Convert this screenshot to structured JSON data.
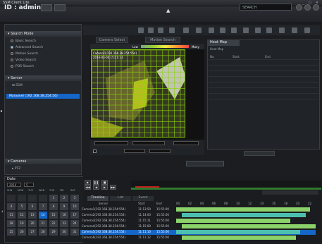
{
  "window": {
    "title": "SSM Client Lite",
    "controls": "_ ▢ ✕"
  },
  "header": {
    "user": "ID : admin",
    "search_label": "SEARCH"
  },
  "sidebar": {
    "search_mode_title": "Search Mode",
    "modes": [
      {
        "label": "Basic Search",
        "selected": false
      },
      {
        "label": "Advanced Search",
        "selected": true
      },
      {
        "label": "Motion Search",
        "selected": false
      },
      {
        "label": "Video Search",
        "selected": false
      },
      {
        "label": "POS Search",
        "selected": false
      }
    ],
    "server_title": "Server",
    "server_node": "SSM",
    "device_label": "Maroonel (192.168.38.254:56)",
    "cameras_title": "Cameras",
    "cameras_node": "PTZ"
  },
  "tabs": {
    "camera_select": "Camera Select",
    "motion_search": "Motion Search",
    "heat_map": "Heat Map"
  },
  "video": {
    "camera_name": "Camera1(192.168.38.254:554)",
    "timestamp": "2016-03-04 15:11:13",
    "legend_low": "Low",
    "legend_high": "Many"
  },
  "heatmap": {
    "subtitle": "Heat Map",
    "columns": [
      "No.",
      "Start",
      "End"
    ]
  },
  "calendar": {
    "title": "Date",
    "year": "2014",
    "month": "5",
    "days_header": [
      "SUN",
      "MON",
      "TUE",
      "WED",
      "THU",
      "FRI",
      "SAT"
    ],
    "weeks": [
      [
        "",
        "",
        "",
        "",
        "1",
        "2",
        "3"
      ],
      [
        "4",
        "5",
        "6",
        "7",
        "8",
        "9",
        "10"
      ],
      [
        "11",
        "12",
        "13",
        "14",
        "15",
        "16",
        "17"
      ],
      [
        "18",
        "19",
        "20",
        "21",
        "22",
        "23",
        "24"
      ],
      [
        "25",
        "26",
        "27",
        "28",
        "29",
        "30",
        "31"
      ]
    ],
    "selected_day": "14"
  },
  "timeline": {
    "tabs": [
      "Timeline",
      "List",
      "Event"
    ],
    "headers": [
      "Server",
      "Start",
      "End"
    ],
    "hours": [
      "00",
      "02",
      "04",
      "06",
      "08",
      "10",
      "12",
      "14",
      "16",
      "18",
      "20",
      "22"
    ],
    "rows": [
      {
        "name": "Camera1(192.168.38.254:554)",
        "start": "11:13:50",
        "end": "15:55:00"
      },
      {
        "name": "Camera2(192.168.38.254:554)",
        "start": "11:14:00",
        "end": "15:55:00"
      },
      {
        "name": "Camera3(192.168.38.254:554)",
        "start": "11:15:11",
        "end": "15:55:00"
      },
      {
        "name": "Camera4(192.168.38.254:554)",
        "start": "11:15:00",
        "end": "15:55:00"
      },
      {
        "name": "Camera5(192.168.38.254:554)",
        "start": "11:11:10",
        "end": "15:55:00"
      },
      {
        "name": "Camera6(192.168.38.254:554)",
        "start": "11:11:12",
        "end": "15:55:00"
      }
    ],
    "selected_row": 4
  },
  "colors": {
    "accent": "#1466c8",
    "grid": "#7ecb00",
    "timeline_rec": "#8cd26a",
    "marker": "#c31d1d"
  }
}
